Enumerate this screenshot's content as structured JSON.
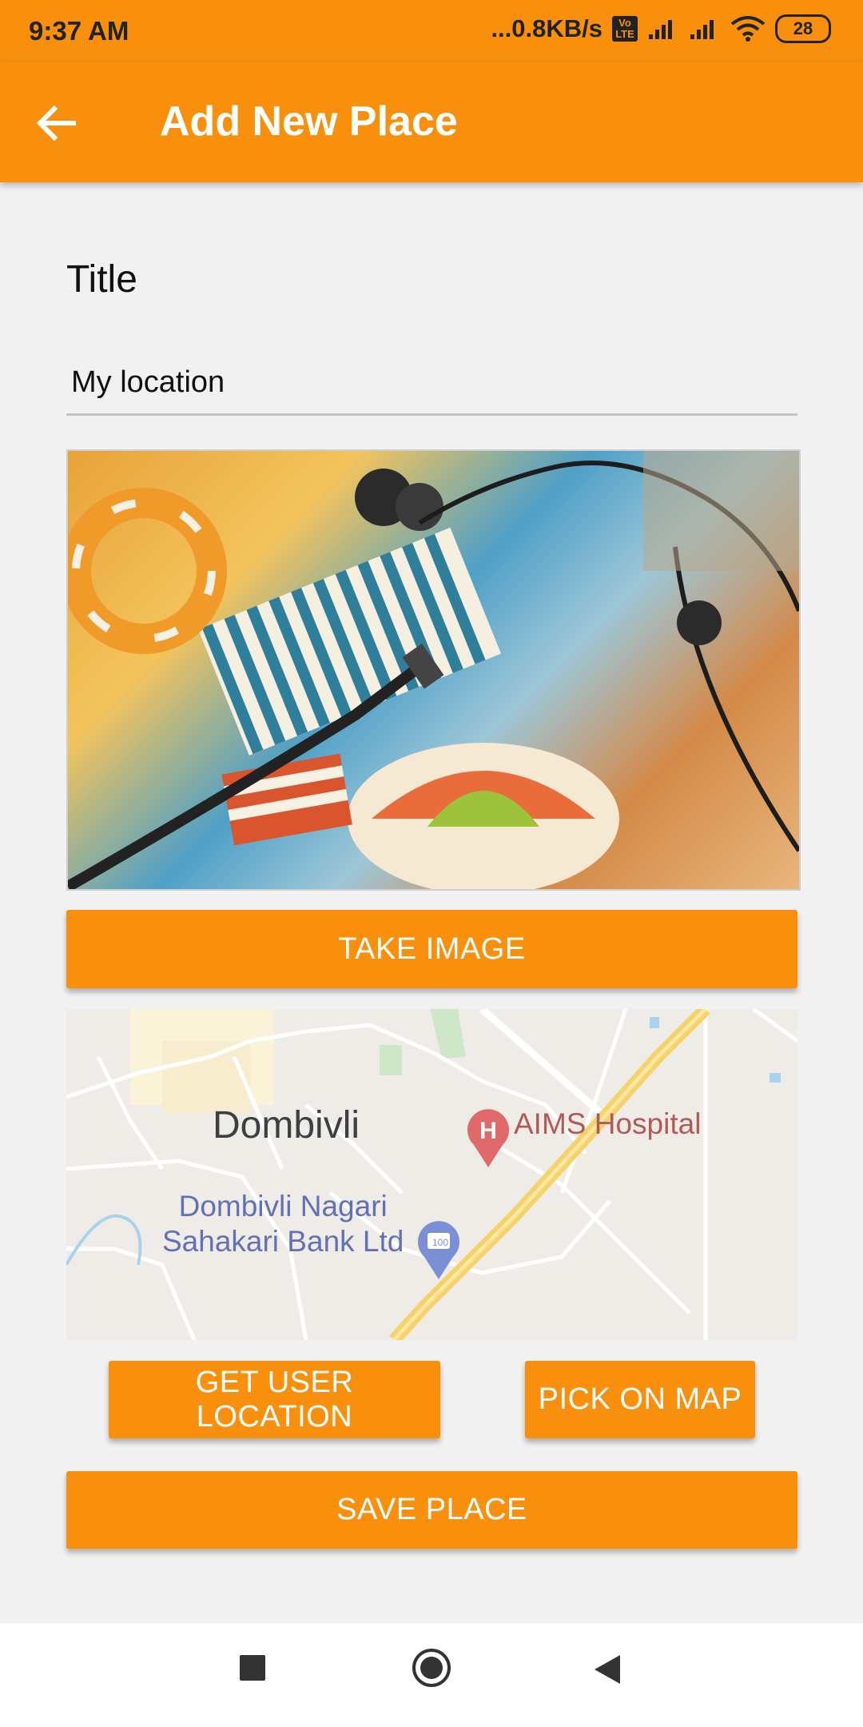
{
  "status_bar": {
    "time": "9:37 AM",
    "network_speed": "...0.8KB/s",
    "volte": "Vo LTE",
    "battery": "28"
  },
  "app_bar": {
    "title": "Add New Place",
    "back_icon": "arrow-back-icon"
  },
  "form": {
    "title_label": "Title",
    "title_value": "My location",
    "title_placeholder": "Title"
  },
  "buttons": {
    "take_image": "TAKE IMAGE",
    "get_user_location": "GET USER LOCATION",
    "pick_on_map": "PICK ON MAP",
    "save_place": "SAVE PLACE"
  },
  "map": {
    "city_label": "Dombivli",
    "hospital_label": "AIMS Hospital",
    "hospital_pin_letter": "H",
    "bank_label_line1": "Dombivli Nagari",
    "bank_label_line2": "Sahakari Bank Ltd",
    "bank_pin_text": "100"
  },
  "nav_bar": {
    "items": [
      "recents-icon",
      "home-icon",
      "back-icon"
    ]
  },
  "colors": {
    "accent": "#f8900e",
    "background": "#f1f1f1"
  }
}
